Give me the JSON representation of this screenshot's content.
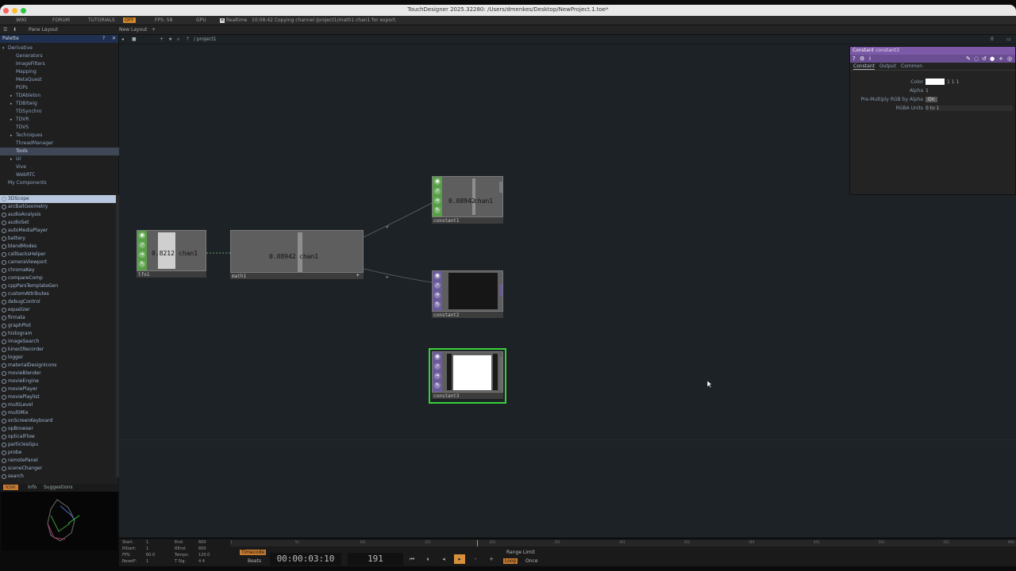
{
  "window": {
    "title": "TouchDesigner 2025.32280: /Users/dmenkes/Desktop/NewProject.1.toe*"
  },
  "menubar": {
    "wiki": "WIKI",
    "forum": "FORUM",
    "tutorials": "TUTORIALS",
    "badge": "OFF",
    "fps_label": "FPS: 58",
    "gpu": "GPU",
    "realtime": "Realtime",
    "status": "10:08:42 Copying channel /project1/math1 chan1 for export."
  },
  "toolbar2": {
    "pane_layout": "Pane Layout",
    "new_layout": "New Layout"
  },
  "network_toolbar": {
    "path": "/ project1",
    "counter": "0"
  },
  "palette": {
    "title": "Palette",
    "tree": [
      {
        "label": "Derivative",
        "level": 0,
        "arrow": "▾"
      },
      {
        "label": "Generators",
        "level": 1,
        "arrow": ""
      },
      {
        "label": "ImageFilters",
        "level": 1,
        "arrow": ""
      },
      {
        "label": "Mapping",
        "level": 1,
        "arrow": ""
      },
      {
        "label": "MetaQuest",
        "level": 1,
        "arrow": ""
      },
      {
        "label": "POPs",
        "level": 1,
        "arrow": ""
      },
      {
        "label": "TDAbleton",
        "level": 1,
        "arrow": "▸"
      },
      {
        "label": "TDBitwig",
        "level": 1,
        "arrow": "▸"
      },
      {
        "label": "TDSynchro",
        "level": 1,
        "arrow": ""
      },
      {
        "label": "TDVR",
        "level": 1,
        "arrow": "▸"
      },
      {
        "label": "TDVS",
        "level": 1,
        "arrow": ""
      },
      {
        "label": "Techniques",
        "level": 1,
        "arrow": "▸"
      },
      {
        "label": "ThreadManager",
        "level": 1,
        "arrow": ""
      },
      {
        "label": "Tools",
        "level": 1,
        "arrow": "",
        "selected": true
      },
      {
        "label": "UI",
        "level": 1,
        "arrow": "▸"
      },
      {
        "label": "Vive",
        "level": 1,
        "arrow": ""
      },
      {
        "label": "WebRTC",
        "level": 1,
        "arrow": ""
      },
      {
        "label": "My Components",
        "level": 0,
        "arrow": ""
      }
    ],
    "components": [
      "3DScope",
      "arcBallGeometry",
      "audioAnalysis",
      "audioSet",
      "autoMediaPlayer",
      "battery",
      "blendModes",
      "callbacksHelper",
      "cameraViewport",
      "chromaKey",
      "compareComp",
      "cppParsTemplateGen",
      "customAttributes",
      "debugControl",
      "equalizer",
      "firmata",
      "graphPlot",
      "histogram",
      "imageSearch",
      "kinectRecorder",
      "logger",
      "materialDesignIcons",
      "movieBlender",
      "movieEngine",
      "moviePlayer",
      "moviePlaylist",
      "multiLevel",
      "multiMix",
      "onScreenKeyboard",
      "opBrowser",
      "opticalFlow",
      "particlesGpu",
      "probe",
      "remotePanel",
      "sceneChanger",
      "search"
    ],
    "selected_component": "3DScope",
    "bottom_tabs": [
      "Icon",
      "Info",
      "Suggestions"
    ]
  },
  "nodes": {
    "lfo1": {
      "name": "lfo1",
      "value": "0.8212",
      "chan": "chan1"
    },
    "math1": {
      "name": "math1",
      "value": "0.08942",
      "chan": "chan1"
    },
    "constant1": {
      "name": "constant1",
      "value": "0.08942",
      "chan": "chan1"
    },
    "constant2": {
      "name": "constant2"
    },
    "constant3": {
      "name": "constant3"
    }
  },
  "params": {
    "op_type": "Constant",
    "op_name": "constant3",
    "tabs": [
      "Constant",
      "Output",
      "Common"
    ],
    "rows": [
      {
        "label": "Color",
        "value": "1          1          1"
      },
      {
        "label": "Alpha",
        "value": "1"
      },
      {
        "label": "Pre-Multiply RGB by Alpha",
        "value": "On"
      },
      {
        "label": "RGBA Units",
        "value": "0 to 1"
      }
    ]
  },
  "timeline": {
    "stats": [
      {
        "k": "Start:",
        "v": "1"
      },
      {
        "k": "RStart:",
        "v": "1"
      },
      {
        "k": "FPS:",
        "v": "60.0"
      },
      {
        "k": "ResetF:",
        "v": "1"
      }
    ],
    "stats2": [
      {
        "k": "End:",
        "v": "600"
      },
      {
        "k": "REnd:",
        "v": "600"
      },
      {
        "k": "Tempo:",
        "v": "120.0"
      },
      {
        "k": "T Sig:",
        "v": "4     4"
      }
    ],
    "timecode_label": "Timecode",
    "beats_label": "Beats",
    "timecode": "00:00:03:10",
    "frame": "191",
    "range_limit": "Range Limit",
    "loop": "Loop",
    "once": "Once",
    "ticks": [
      "1",
      "51",
      "101",
      "151",
      "201",
      "251",
      "301",
      "351",
      "401",
      "451",
      "501",
      "551",
      "600"
    ]
  }
}
